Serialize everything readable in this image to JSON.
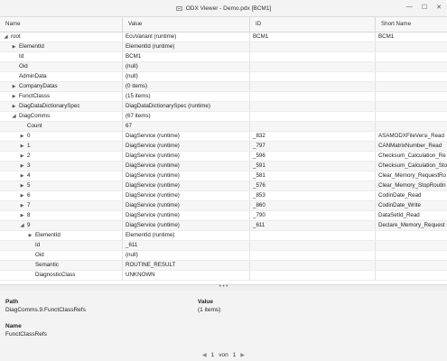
{
  "window": {
    "title": "ODX Viewer - Demo.pdx [BCM1]",
    "minimize": "—",
    "maximize": "☐",
    "close": "✕"
  },
  "columns": {
    "name": "Name",
    "value": "Value",
    "id": "ID",
    "short_name": "Short Name"
  },
  "rows": [
    {
      "indent": 0,
      "toggle": "open",
      "name": "root",
      "value": "EcuVariant (runtime)",
      "id": "BCM1",
      "short_name": "BCM1"
    },
    {
      "indent": 1,
      "toggle": "closed",
      "name": "ElementId",
      "value": "ElementId (runtime)",
      "id": "",
      "short_name": ""
    },
    {
      "indent": 1,
      "toggle": "none",
      "name": "Id",
      "value": "BCM1",
      "id": "",
      "short_name": ""
    },
    {
      "indent": 1,
      "toggle": "none",
      "name": "Oid",
      "value": "(null)",
      "id": "",
      "short_name": ""
    },
    {
      "indent": 1,
      "toggle": "none",
      "name": "AdminData",
      "value": "(null)",
      "id": "",
      "short_name": ""
    },
    {
      "indent": 1,
      "toggle": "closed",
      "name": "CompanyDatas",
      "value": "(0 items)",
      "id": "",
      "short_name": ""
    },
    {
      "indent": 1,
      "toggle": "closed",
      "name": "FunctClasss",
      "value": "(15 items)",
      "id": "",
      "short_name": ""
    },
    {
      "indent": 1,
      "toggle": "closed",
      "name": "DiagDataDictionarySpec",
      "value": "DiagDataDictionarySpec (runtime)",
      "id": "",
      "short_name": ""
    },
    {
      "indent": 1,
      "toggle": "open",
      "name": "DiagComms",
      "value": "(67 items)",
      "id": "",
      "short_name": ""
    },
    {
      "indent": 2,
      "toggle": "none",
      "name": "Count",
      "value": "67",
      "id": "",
      "short_name": ""
    },
    {
      "indent": 2,
      "toggle": "closed",
      "name": "0",
      "value": "DiagService (runtime)",
      "id": "_832",
      "short_name": "ASAMODXFileVersi_Read"
    },
    {
      "indent": 2,
      "toggle": "closed",
      "name": "1",
      "value": "DiagService (runtime)",
      "id": "_797",
      "short_name": "CANMatrixNumber_Read"
    },
    {
      "indent": 2,
      "toggle": "closed",
      "name": "2",
      "value": "DiagService (runtime)",
      "id": "_596",
      "short_name": "Checksum_Calculation_Re"
    },
    {
      "indent": 2,
      "toggle": "closed",
      "name": "3",
      "value": "DiagService (runtime)",
      "id": "_591",
      "short_name": "Checksum_Calculation_Sto"
    },
    {
      "indent": 2,
      "toggle": "closed",
      "name": "4",
      "value": "DiagService (runtime)",
      "id": "_581",
      "short_name": "Clear_Memory_RequestRo"
    },
    {
      "indent": 2,
      "toggle": "closed",
      "name": "5",
      "value": "DiagService (runtime)",
      "id": "_576",
      "short_name": "Clear_Memory_StopRoutin"
    },
    {
      "indent": 2,
      "toggle": "closed",
      "name": "6",
      "value": "DiagService (runtime)",
      "id": "_853",
      "short_name": "CodinDate_Read"
    },
    {
      "indent": 2,
      "toggle": "closed",
      "name": "7",
      "value": "DiagService (runtime)",
      "id": "_860",
      "short_name": "CodinDate_Write"
    },
    {
      "indent": 2,
      "toggle": "closed",
      "name": "8",
      "value": "DiagService (runtime)",
      "id": "_790",
      "short_name": "DataSetId_Read"
    },
    {
      "indent": 2,
      "toggle": "open",
      "name": "9",
      "value": "DiagService (runtime)",
      "id": "_611",
      "short_name": "Declare_Memory_Request"
    },
    {
      "indent": 3,
      "toggle": "closed",
      "name": "ElementId",
      "value": "ElementId (runtime)",
      "id": "",
      "short_name": ""
    },
    {
      "indent": 3,
      "toggle": "none",
      "name": "Id",
      "value": "_611",
      "id": "",
      "short_name": ""
    },
    {
      "indent": 3,
      "toggle": "none",
      "name": "Oid",
      "value": "(null)",
      "id": "",
      "short_name": ""
    },
    {
      "indent": 3,
      "toggle": "none",
      "name": "Semantic",
      "value": "ROUTINE_RESULT",
      "id": "",
      "short_name": ""
    },
    {
      "indent": 3,
      "toggle": "none",
      "name": "DiagnosticClass",
      "value": "UNKNOWN",
      "id": "",
      "short_name": ""
    }
  ],
  "splitter": {
    "grip": "• • •"
  },
  "details": {
    "path_label": "Path",
    "path_value": "DiagComms.9.FunctClassRefs",
    "value_label": "Value",
    "value_value": "(1 items)",
    "name_label": "Name",
    "name_value": "FunctClassRefs"
  },
  "pager": {
    "prev": "◀",
    "current": "1",
    "of_label": "von",
    "total": "1",
    "next": "▶"
  }
}
